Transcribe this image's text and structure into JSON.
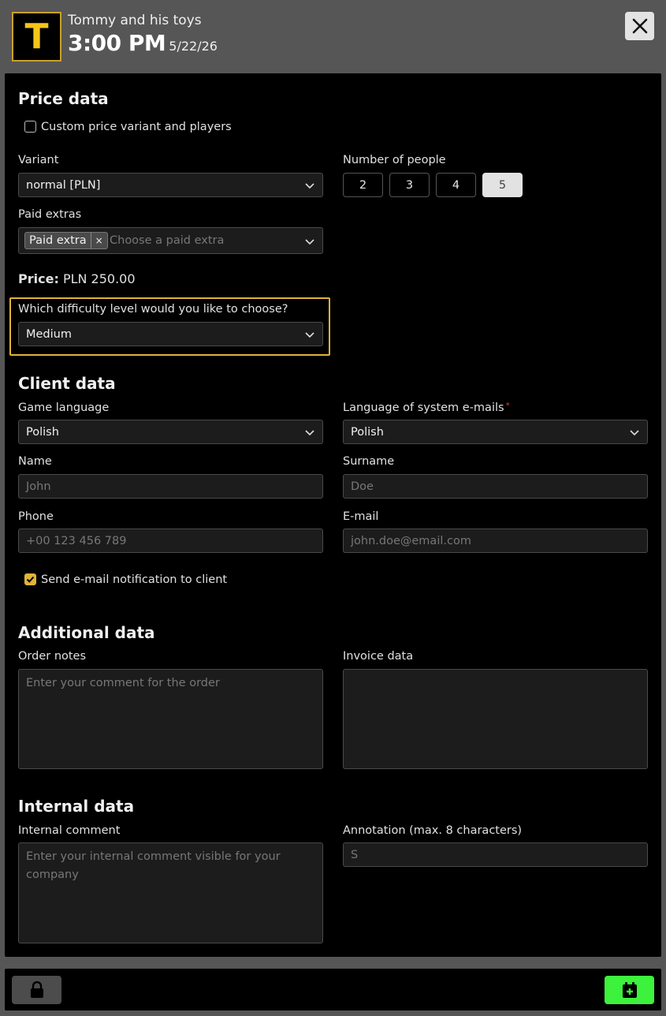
{
  "header": {
    "logo_letter": "T",
    "room_name": "Tommy and his toys",
    "time": "3:00 PM",
    "date": "5/22/26"
  },
  "price": {
    "heading": "Price data",
    "custom_label": "Custom price variant and players",
    "custom_checked": false,
    "variant_label": "Variant",
    "variant_value": "normal [PLN]",
    "people_label": "Number of people",
    "people_options": [
      "2",
      "3",
      "4",
      "5"
    ],
    "people_selected": "5",
    "extras_label": "Paid extras",
    "extras_chip": "Paid extra",
    "extras_chip_remove": "×",
    "extras_placeholder": "Choose a paid extra",
    "price_label": "Price:",
    "price_value": "PLN 250.00",
    "difficulty_question": "Which difficulty level would you like to choose?",
    "difficulty_value": "Medium"
  },
  "client": {
    "heading": "Client data",
    "game_language_label": "Game language",
    "game_language_value": "Polish",
    "email_language_label": "Language of system e-mails",
    "email_language_required": "*",
    "email_language_value": "Polish",
    "name_label": "Name",
    "name_placeholder": "John",
    "surname_label": "Surname",
    "surname_placeholder": "Doe",
    "phone_label": "Phone",
    "phone_placeholder": "+00 123 456 789",
    "email_label": "E-mail",
    "email_placeholder": "john.doe@email.com",
    "notify_label": "Send e-mail notification to client",
    "notify_checked": true
  },
  "additional": {
    "heading": "Additional data",
    "order_notes_label": "Order notes",
    "order_notes_placeholder": "Enter your comment for the order",
    "invoice_label": "Invoice data",
    "invoice_value": ""
  },
  "internal": {
    "heading": "Internal data",
    "comment_label": "Internal comment",
    "comment_placeholder": "Enter your internal comment visible for your company",
    "annotation_label": "Annotation (max. 8 characters)",
    "annotation_placeholder": "S"
  },
  "footer": {
    "lock_icon": "lock-icon",
    "book_icon": "calendar-plus-icon"
  },
  "colors": {
    "accent": "#e0b33a",
    "confirm": "#3cf23c",
    "logo_text": "#f5c518"
  }
}
